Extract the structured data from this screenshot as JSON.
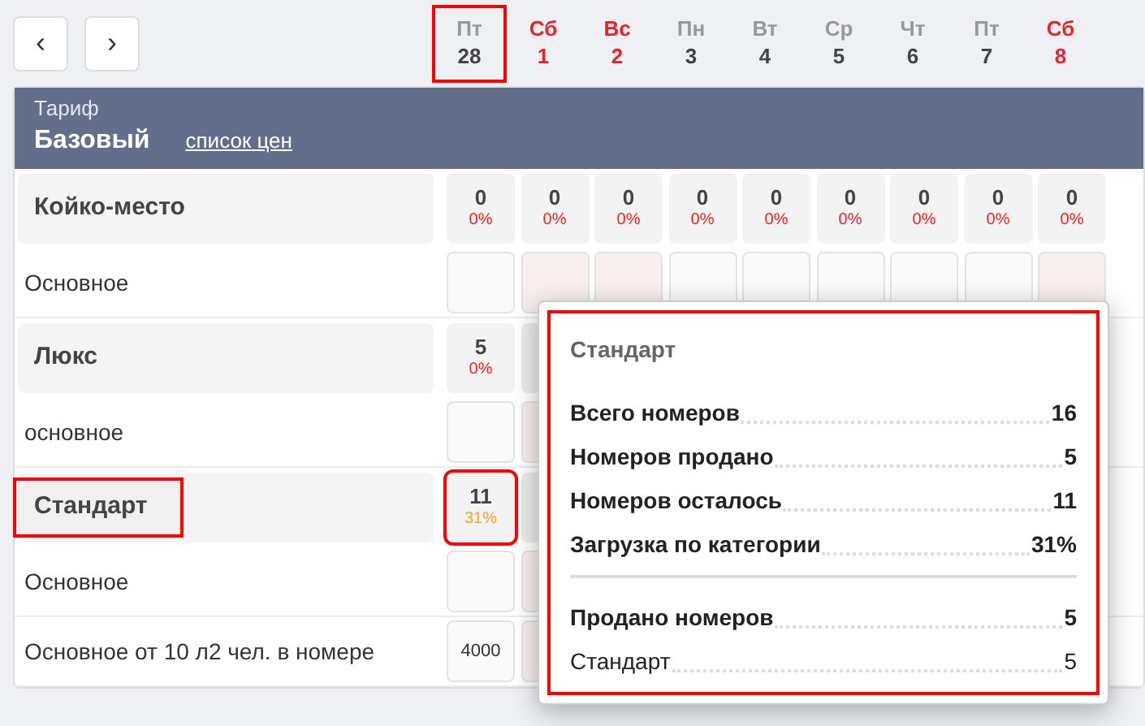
{
  "nav": {
    "prev": "‹",
    "next": "›"
  },
  "days": [
    {
      "weekday": "Пт",
      "date": "28",
      "weekend": false,
      "highlighted": true
    },
    {
      "weekday": "Сб",
      "date": "1",
      "weekend": true,
      "highlighted": false
    },
    {
      "weekday": "Вс",
      "date": "2",
      "weekend": true,
      "highlighted": false
    },
    {
      "weekday": "Пн",
      "date": "3",
      "weekend": false,
      "highlighted": false
    },
    {
      "weekday": "Вт",
      "date": "4",
      "weekend": false,
      "highlighted": false
    },
    {
      "weekday": "Ср",
      "date": "5",
      "weekend": false,
      "highlighted": false
    },
    {
      "weekday": "Чт",
      "date": "6",
      "weekend": false,
      "highlighted": false
    },
    {
      "weekday": "Пт",
      "date": "7",
      "weekend": false,
      "highlighted": false
    },
    {
      "weekday": "Сб",
      "date": "8",
      "weekend": true,
      "highlighted": false
    }
  ],
  "tariff": {
    "label": "Тариф",
    "name": "Базовый",
    "link": "список цен"
  },
  "rows": [
    {
      "kind": "group",
      "label": "Койко-место",
      "highlighted": false,
      "cells": [
        {
          "count": "0",
          "percent": "0%",
          "color": "#ff1a1a",
          "highlighted": false
        },
        {
          "count": "0",
          "percent": "0%",
          "color": "#ff1a1a",
          "highlighted": false
        },
        {
          "count": "0",
          "percent": "0%",
          "color": "#ff1a1a",
          "highlighted": false
        },
        {
          "count": "0",
          "percent": "0%",
          "color": "#ff1a1a",
          "highlighted": false
        },
        {
          "count": "0",
          "percent": "0%",
          "color": "#ff1a1a",
          "highlighted": false
        },
        {
          "count": "0",
          "percent": "0%",
          "color": "#ff1a1a",
          "highlighted": false
        },
        {
          "count": "0",
          "percent": "0%",
          "color": "#ff1a1a",
          "highlighted": false
        },
        {
          "count": "0",
          "percent": "0%",
          "color": "#ff1a1a",
          "highlighted": false
        },
        {
          "count": "0",
          "percent": "0%",
          "color": "#ff1a1a",
          "highlighted": false
        }
      ]
    },
    {
      "kind": "rate",
      "label": "Основное",
      "cells": []
    },
    {
      "kind": "group",
      "label": "Люкс",
      "highlighted": false,
      "cells": [
        {
          "kind": "stats",
          "count": "5",
          "percent": "0%",
          "color": "#ff1a1a",
          "highlighted": false
        },
        {
          "kind": "covered"
        }
      ]
    },
    {
      "kind": "rate",
      "label": "основное",
      "cells": []
    },
    {
      "kind": "group",
      "label": "Стандарт",
      "highlighted": true,
      "cells": [
        {
          "kind": "stats",
          "count": "11",
          "percent": "31%",
          "color": "#f5a623",
          "highlighted": true
        },
        {
          "kind": "covered"
        }
      ]
    },
    {
      "kind": "rate",
      "label": "Основное",
      "cells": []
    },
    {
      "kind": "rate",
      "label": "Основное от 10 л2 чел. в номере",
      "cells": [
        {
          "price": "4000"
        }
      ]
    }
  ],
  "popover": {
    "title": "Стандарт",
    "highlighted": true,
    "sections": [
      [
        {
          "label": "Всего номеров",
          "value": "16",
          "bold": true
        },
        {
          "label": "Номеров продано",
          "value": "5",
          "bold": true
        },
        {
          "label": "Номеров осталось",
          "value": "11",
          "bold": true
        },
        {
          "label": "Загрузка по категории",
          "value": "31%",
          "bold": true
        }
      ],
      [
        {
          "label": "Продано номеров",
          "value": "5",
          "bold": true
        },
        {
          "label": "Стандарт",
          "value": "5",
          "bold": false
        }
      ]
    ]
  }
}
